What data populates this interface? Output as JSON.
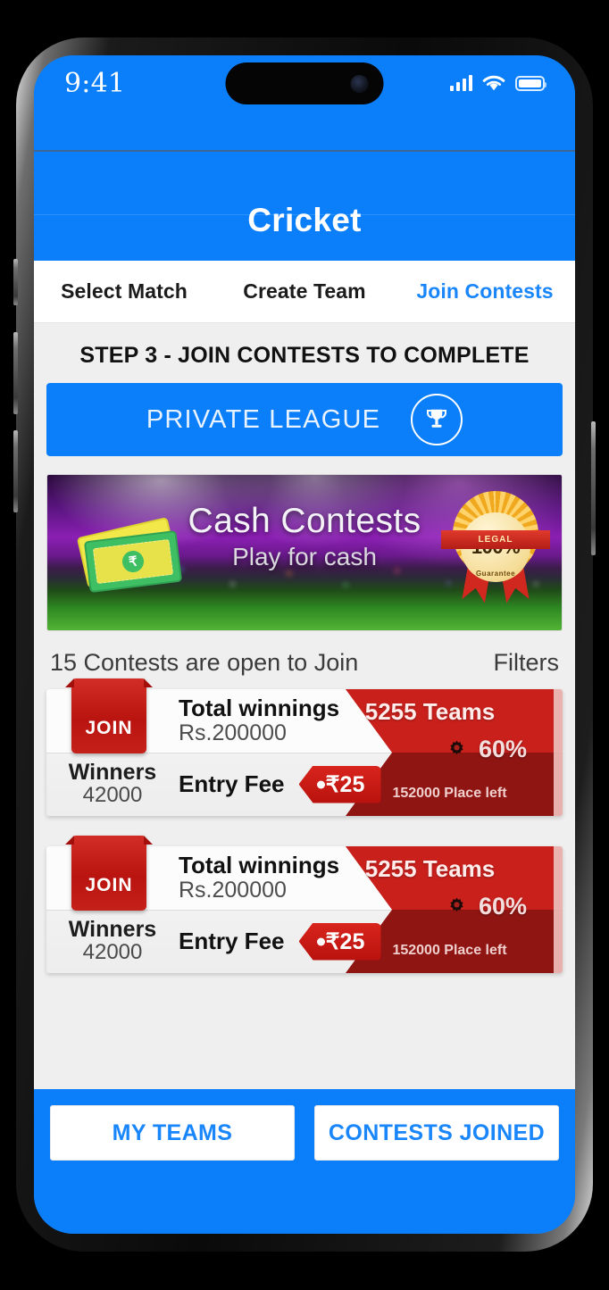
{
  "status_bar": {
    "time": "9:41",
    "signal_icon": "cellular-signal-icon",
    "wifi_icon": "wifi-icon",
    "battery_icon": "battery-icon"
  },
  "nav": {
    "title": "Cricket"
  },
  "tabs": [
    {
      "label": "Select Match",
      "active": false
    },
    {
      "label": "Create Team",
      "active": false
    },
    {
      "label": "Join Contests",
      "active": true
    }
  ],
  "main": {
    "step_title": "STEP 3 - JOIN CONTESTS TO COMPLETE",
    "private_league": {
      "label": "PRIVATE LEAGUE",
      "icon": "trophy-icon"
    },
    "banner": {
      "title": "Cash Contests",
      "subtitle": "Play for cash",
      "badge_percent": "100%",
      "badge_band": "LEGAL",
      "badge_guarantee": "Guarantee",
      "money_icon": "cash-notes-icon",
      "currency_symbol": "₹"
    },
    "contests_header": {
      "count_text": "15 Contests are open to Join",
      "filters_label": "Filters"
    },
    "contests": [
      {
        "join_label": "JOIN",
        "winners_label": "Winners",
        "winners_value": "42000",
        "total_label": "Total winnings",
        "total_value": "Rs.200000",
        "entry_label": "Entry Fee",
        "entry_fee": "₹25",
        "teams": "5255 Teams",
        "percent": "60%",
        "percent_icon": "gear-icon",
        "places_left": "152000 Place left"
      },
      {
        "join_label": "JOIN",
        "winners_label": "Winners",
        "winners_value": "42000",
        "total_label": "Total winnings",
        "total_value": "Rs.200000",
        "entry_label": "Entry Fee",
        "entry_fee": "₹25",
        "teams": "5255 Teams",
        "percent": "60%",
        "percent_icon": "gear-icon",
        "places_left": "152000 Place left"
      }
    ]
  },
  "footer": {
    "my_teams_label": "MY TEAMS",
    "contests_joined_label": "CONTESTS JOINED"
  },
  "colors": {
    "brand_blue": "#0b7ffa",
    "tab_active": "#1a86fb",
    "card_red": "#c9201c",
    "card_red_dark": "#8e1512",
    "join_red": "#b9140f"
  }
}
